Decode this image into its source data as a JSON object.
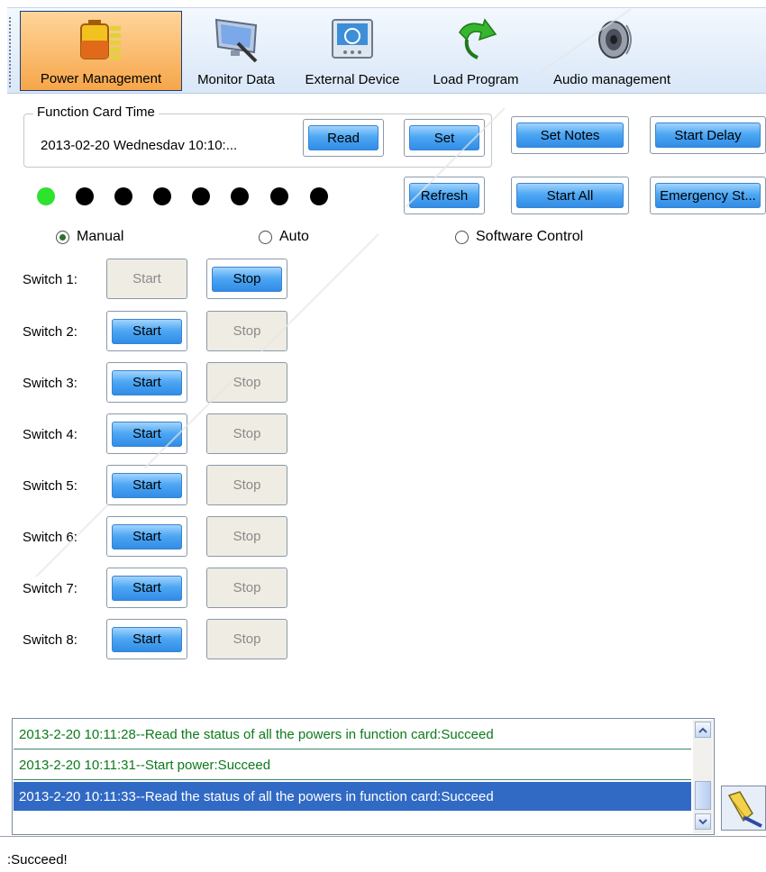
{
  "toolbar": {
    "items": [
      {
        "label": "Power Management",
        "icon": "battery-icon"
      },
      {
        "label": "Monitor Data",
        "icon": "monitor-icon"
      },
      {
        "label": "External Device",
        "icon": "gauge-icon"
      },
      {
        "label": "Load Program",
        "icon": "arrow-icon"
      },
      {
        "label": "Audio management",
        "icon": "speaker-icon"
      }
    ],
    "active": "Power Management"
  },
  "function_card_time": {
    "legend": "Function Card Time",
    "value": "2013-02-20 Wednesdav 10:10:..."
  },
  "buttons": {
    "read": "Read",
    "set": "Set",
    "set_notes": "Set Notes",
    "start_delay": "Start Delay",
    "refresh": "Refresh",
    "start_all": "Start All",
    "emergency_stop": "Emergency St..."
  },
  "indicators": [
    true,
    false,
    false,
    false,
    false,
    false,
    false,
    false
  ],
  "mode": {
    "options": [
      "Manual",
      "Auto",
      "Software Control"
    ],
    "selected": "Manual"
  },
  "switches": [
    {
      "label": "Switch 1:",
      "start": "Start",
      "stop": "Stop",
      "running": true
    },
    {
      "label": "Switch 2:",
      "start": "Start",
      "stop": "Stop",
      "running": false
    },
    {
      "label": "Switch 3:",
      "start": "Start",
      "stop": "Stop",
      "running": false
    },
    {
      "label": "Switch 4:",
      "start": "Start",
      "stop": "Stop",
      "running": false
    },
    {
      "label": "Switch 5:",
      "start": "Start",
      "stop": "Stop",
      "running": false
    },
    {
      "label": "Switch 6:",
      "start": "Start",
      "stop": "Stop",
      "running": false
    },
    {
      "label": "Switch 7:",
      "start": "Start",
      "stop": "Stop",
      "running": false
    },
    {
      "label": "Switch 8:",
      "start": "Start",
      "stop": "Stop",
      "running": false
    }
  ],
  "log": {
    "entries": [
      "2013-2-20 10:11:28--Read the status of all the powers in function card:Succeed",
      "2013-2-20 10:11:31--Start power:Succeed",
      "2013-2-20 10:11:33--Read the status of all the powers in function card:Succeed"
    ],
    "selected_index": 2
  },
  "status": ":Succeed!",
  "colors": {
    "active_tab": "#f6a64a",
    "button_blue": "#4fa8f3",
    "indicator_on": "#2ee22e",
    "log_text": "#0d7a1a",
    "selection": "#316ac5"
  }
}
